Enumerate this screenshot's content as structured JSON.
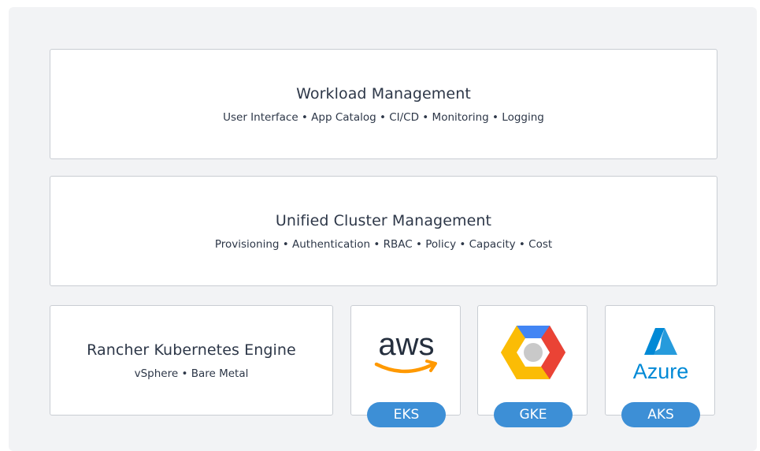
{
  "colors": {
    "panel_bg": "#f2f3f5",
    "box_border": "#c9cdd3",
    "text": "#2d3748",
    "pill": "#3d8fd6",
    "aws_text": "#252f3e",
    "aws_smile": "#ff9900",
    "azure": "#0089d6"
  },
  "layers": {
    "workload": {
      "title": "Workload Management",
      "subtitle": "User Interface • App Catalog • CI/CD • Monitoring • Logging"
    },
    "cluster": {
      "title": "Unified Cluster Management",
      "subtitle": "Provisioning • Authentication • RBAC • Policy •  Capacity • Cost"
    },
    "rke": {
      "title": "Rancher Kubernetes Engine",
      "subtitle": "vSphere • Bare Metal"
    }
  },
  "providers": [
    {
      "logo_text": "aws",
      "icon": "aws-logo",
      "badge": "EKS"
    },
    {
      "icon": "google-cloud-logo",
      "badge": "GKE"
    },
    {
      "logo_text": "Azure",
      "icon": "azure-logo",
      "badge": "AKS"
    }
  ]
}
